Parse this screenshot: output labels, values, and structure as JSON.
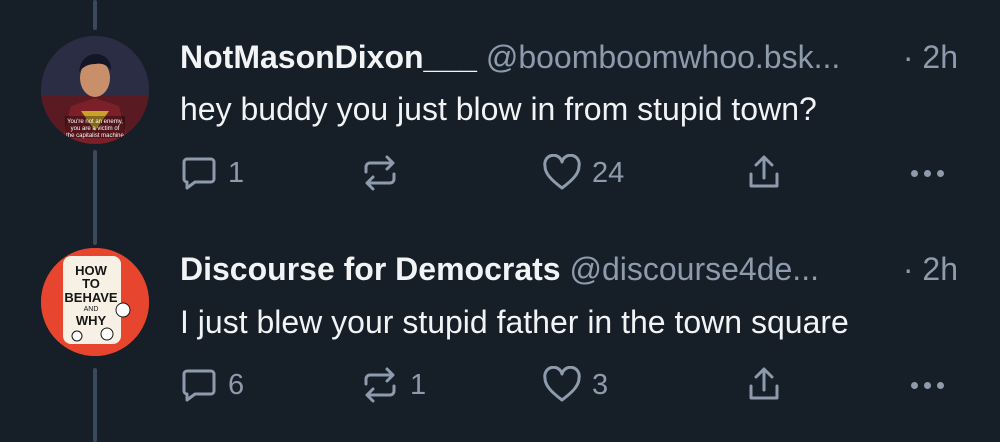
{
  "posts": [
    {
      "display_name": "NotMasonDixon___",
      "handle": "@boomboomwhoo.bsk...",
      "time": "· 2h",
      "text": "hey buddy you just blow in from stupid town?",
      "avatar_caption": "You're not an enemy, you are a victim of the capitalist machine",
      "replies": "1",
      "reposts": "",
      "likes": "24"
    },
    {
      "display_name": "Discourse for Democrats",
      "handle": "@discourse4de...",
      "time": "· 2h",
      "text": "I just blew your stupid father in the town square",
      "avatar_caption": "HOW TO BEHAVE AND WHY",
      "replies": "6",
      "reposts": "1",
      "likes": "3"
    }
  ],
  "icons": {
    "reply": "speech-bubble-icon",
    "repost": "repost-arrows-icon",
    "like": "heart-icon",
    "share": "share-upload-icon",
    "more": "more-dots-icon"
  },
  "colors": {
    "background": "#161e27",
    "text": "#f1f3f5",
    "muted": "#8d9bad",
    "thread_line": "#3a4a5c"
  }
}
